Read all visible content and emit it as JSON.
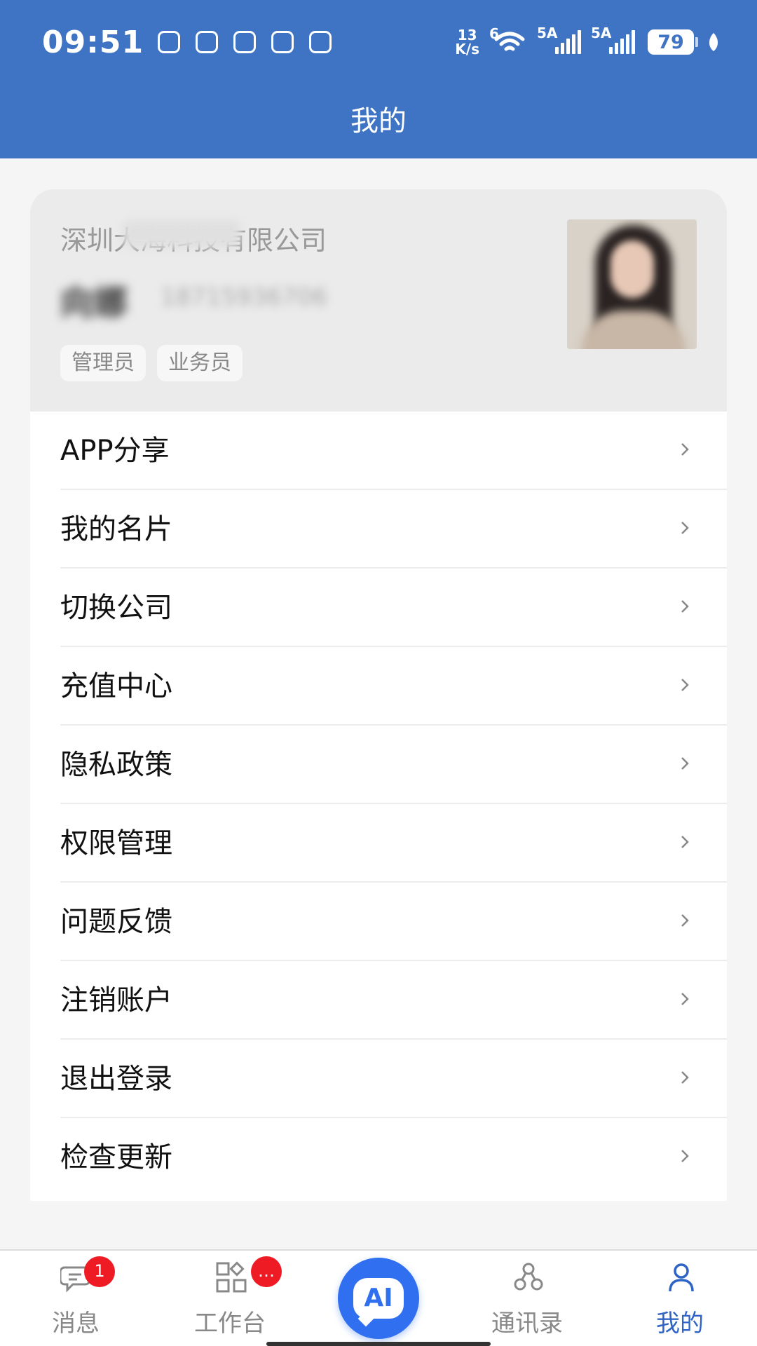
{
  "status_bar": {
    "time": "09:51",
    "net_speed_top": "13",
    "net_speed_bottom": "K/s",
    "wifi_tag": "6",
    "sim1_tag": "5A",
    "sim2_tag": "5A",
    "battery": "79"
  },
  "header": {
    "title": "我的"
  },
  "profile": {
    "company": "深圳大海科技有限公司",
    "name": "向娜",
    "phone": "18715936706",
    "roles": [
      "管理员",
      "业务员"
    ]
  },
  "menu": {
    "items": [
      {
        "label": "APP分享"
      },
      {
        "label": "我的名片"
      },
      {
        "label": "切换公司"
      },
      {
        "label": "充值中心"
      },
      {
        "label": "隐私政策"
      },
      {
        "label": "权限管理"
      },
      {
        "label": "问题反馈"
      },
      {
        "label": "注销账户"
      },
      {
        "label": "退出登录"
      },
      {
        "label": "检查更新"
      }
    ]
  },
  "bottom_nav": {
    "messages": {
      "label": "消息",
      "badge": "1"
    },
    "workbench": {
      "label": "工作台",
      "badge": "…"
    },
    "ai": {
      "label": "AI"
    },
    "contacts": {
      "label": "通讯录"
    },
    "mine": {
      "label": "我的"
    }
  },
  "colors": {
    "brand": "#3e74c3",
    "active_tab": "#2f64c6",
    "badge": "#ee1b24",
    "ai_button": "#2f6ff0"
  }
}
